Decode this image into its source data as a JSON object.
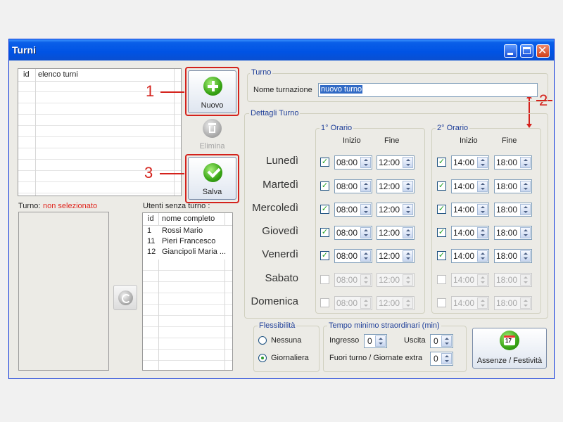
{
  "window": {
    "title": "Turni"
  },
  "shifts_list": {
    "header_id": "id",
    "header_name": "elenco turni",
    "rows": []
  },
  "buttons": {
    "new": "Nuovo",
    "delete": "Elimina",
    "save": "Salva",
    "absences": "Assenze / Festività",
    "absences_day": "17"
  },
  "annotations": [
    "1",
    "2",
    "3"
  ],
  "turno_status": {
    "label": "Turno:",
    "value": "non selezionato",
    "value_color": "#e0271f"
  },
  "users_without_shift": {
    "title": "Utenti senza turno :",
    "header_id": "id",
    "header_name": "nome completo",
    "rows": [
      {
        "id": "1",
        "name": "Rossi Mario"
      },
      {
        "id": "11",
        "name": "Pieri Francesco"
      },
      {
        "id": "12",
        "name": "Giancipoli Maria ..."
      }
    ]
  },
  "turno_group": {
    "title": "Turno",
    "name_label": "Nome turnazione",
    "name_value": "nuovo turno"
  },
  "details": {
    "title": "Dettagli Turno",
    "slot1_title": "1° Orario",
    "slot2_title": "2° Orario",
    "start_label": "Inizio",
    "end_label": "Fine",
    "days": [
      {
        "name": "Lunedì",
        "enabled": true,
        "s1_start": "08:00",
        "s1_end": "12:00",
        "s2_start": "14:00",
        "s2_end": "18:00"
      },
      {
        "name": "Martedì",
        "enabled": true,
        "s1_start": "08:00",
        "s1_end": "12:00",
        "s2_start": "14:00",
        "s2_end": "18:00"
      },
      {
        "name": "Mercoledì",
        "enabled": true,
        "s1_start": "08:00",
        "s1_end": "12:00",
        "s2_start": "14:00",
        "s2_end": "18:00"
      },
      {
        "name": "Giovedì",
        "enabled": true,
        "s1_start": "08:00",
        "s1_end": "12:00",
        "s2_start": "14:00",
        "s2_end": "18:00"
      },
      {
        "name": "Venerdì",
        "enabled": true,
        "s1_start": "08:00",
        "s1_end": "12:00",
        "s2_start": "14:00",
        "s2_end": "18:00"
      },
      {
        "name": "Sabato",
        "enabled": false,
        "s1_start": "08:00",
        "s1_end": "12:00",
        "s2_start": "14:00",
        "s2_end": "18:00"
      },
      {
        "name": "Domenica",
        "enabled": false,
        "s1_start": "08:00",
        "s1_end": "12:00",
        "s2_start": "14:00",
        "s2_end": "18:00"
      }
    ]
  },
  "flex": {
    "title": "Flessibilità",
    "option1": "Nessuna",
    "option2": "Giornaliera",
    "selected": "Giornaliera"
  },
  "overtime": {
    "title": "Tempo minimo straordinari  (min)",
    "in_label": "Ingresso",
    "in_value": "0",
    "out_label": "Uscita",
    "out_value": "0",
    "extra_label": "Fuori turno  /  Giornate extra",
    "extra_value": "0"
  },
  "colors": {
    "titlebar": "#0053e4",
    "accent_red": "#d4221c",
    "group_label": "#1f3f99"
  }
}
